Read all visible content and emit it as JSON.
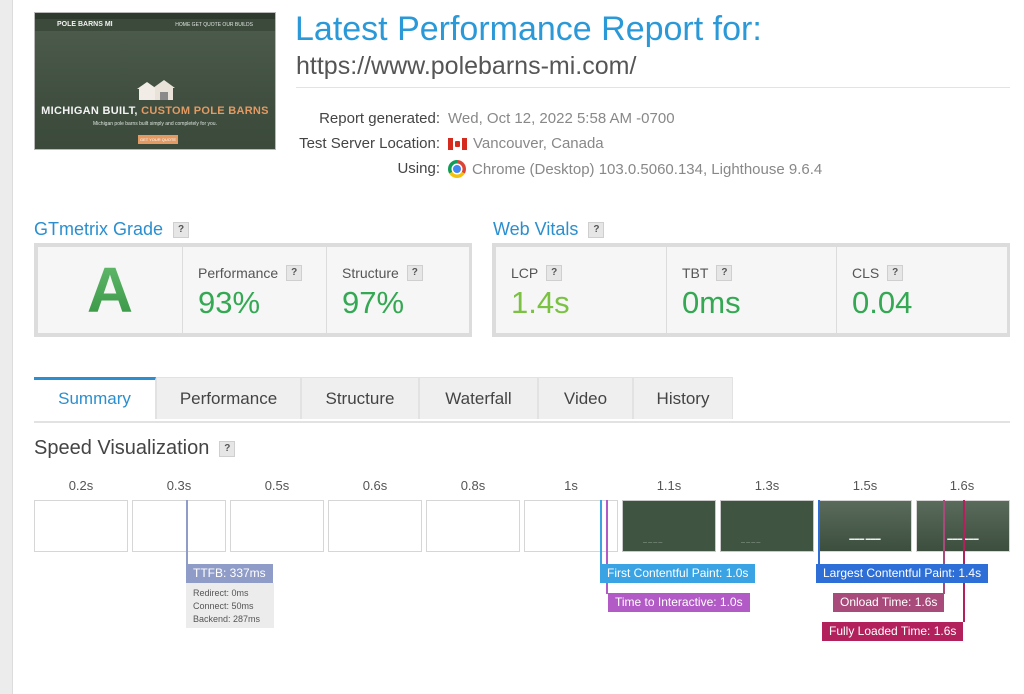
{
  "report": {
    "title": "Latest Performance Report for:",
    "url": "https://www.polebarns-mi.com/",
    "meta": [
      {
        "label": "Report generated:",
        "value": "Wed, Oct 12, 2022 5:58 AM -0700"
      },
      {
        "label": "Test Server Location:",
        "value": "Vancouver, Canada",
        "icon": "canada-flag-icon"
      },
      {
        "label": "Using:",
        "value": "Chrome (Desktop) 103.0.5060.134, Lighthouse 9.6.4",
        "icon": "chrome-icon"
      }
    ]
  },
  "thumbnail": {
    "logo": "POLE BARNS MI",
    "nav": "HOME   GET QUOTE   OUR BUILDS",
    "headline_main": "MICHIGAN BUILT, ",
    "headline_accent": "CUSTOM POLE BARNS",
    "subtext": "Michigan pole barns built simply and completely for you.",
    "cta": "GET YOUR QUOTE"
  },
  "grade": {
    "section_title": "GTmetrix Grade",
    "help": "?",
    "letter": "A",
    "performance_label": "Performance",
    "performance_value": "93%",
    "structure_label": "Structure",
    "structure_value": "97%"
  },
  "vitals": {
    "section_title": "Web Vitals",
    "help": "?",
    "lcp_label": "LCP",
    "lcp_value": "1.4s",
    "tbt_label": "TBT",
    "tbt_value": "0ms",
    "cls_label": "CLS",
    "cls_value": "0.04"
  },
  "tabs": [
    "Summary",
    "Performance",
    "Structure",
    "Waterfall",
    "Video",
    "History"
  ],
  "speed": {
    "title": "Speed Visualization",
    "help": "?",
    "ticks": [
      "0.2s",
      "0.3s",
      "0.5s",
      "0.6s",
      "0.8s",
      "1s",
      "1.1s",
      "1.3s",
      "1.5s",
      "1.6s"
    ],
    "ttfb": {
      "label": "TTFB: 337ms",
      "redirect": "Redirect: 0ms",
      "connect": "Connect: 50ms",
      "backend": "Backend: 287ms"
    },
    "fcp": "First Contentful Paint: 1.0s",
    "tti": "Time to Interactive: 1.0s",
    "lcp": "Largest Contentful Paint: 1.4s",
    "onload": "Onload Time: 1.6s",
    "fully_loaded": "Fully Loaded Time: 1.6s"
  },
  "colors": {
    "accent": "#2b99d7",
    "grade_green": "#34a853",
    "ttfb": "#8f9cc8",
    "fcp": "#3aa3e3",
    "tti": "#b25ac6",
    "lcp": "#2d6fd6",
    "onload": "#a84b7a",
    "fully_loaded": "#b3215c"
  }
}
